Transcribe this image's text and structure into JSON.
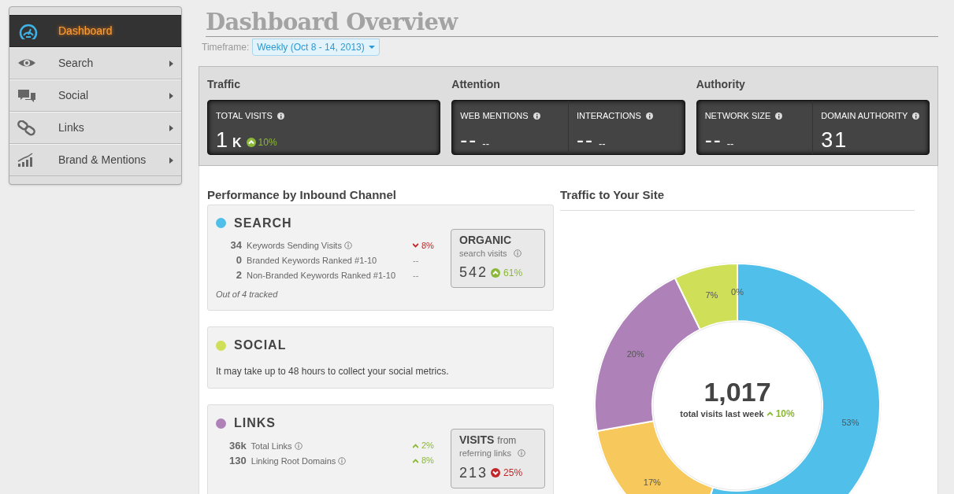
{
  "sidebar": {
    "items": [
      {
        "label": "Dashboard",
        "kind": "gauge",
        "selected": true
      },
      {
        "label": "Search",
        "kind": "eye",
        "selected": false
      },
      {
        "label": "Social",
        "kind": "bubbles",
        "selected": false
      },
      {
        "label": "Links",
        "kind": "chain",
        "selected": false
      },
      {
        "label": "Brand & Mentions",
        "kind": "bars",
        "selected": false
      }
    ]
  },
  "header": {
    "title": "Dashboard Overview",
    "timeframe_label": "Timeframe:",
    "timeframe": "Weekly (Oct 8 - 14, 2013)"
  },
  "summary": [
    {
      "title": "Traffic",
      "metrics": [
        {
          "label": "TOTAL VISITS",
          "value": "1",
          "unit": "K",
          "change": "10%",
          "kind": "up"
        }
      ]
    },
    {
      "title": "Attention",
      "metrics": [
        {
          "label": "WEB MENTIONS",
          "value": "--",
          "unit": "--"
        },
        {
          "label": "INTERACTIONS",
          "value": "--",
          "unit": "--"
        }
      ]
    },
    {
      "title": "Authority",
      "metrics": [
        {
          "label": "NETWORK SIZE",
          "value": "--",
          "unit": "--"
        },
        {
          "label": "DOMAIN AUTHORITY",
          "value": "31"
        }
      ]
    }
  ],
  "performance": {
    "title": "Performance by Inbound Channel",
    "channels": [
      {
        "name": "SEARCH",
        "color": "#4fbfea",
        "rows": [
          {
            "text": "**34** Keywords Sending Visits",
            "info": true,
            "change": "8%",
            "kind": "down"
          },
          {
            "text": "**0** Branded Keywords Ranked #1-10",
            "info": false,
            "change": "--",
            "kind": "flat"
          },
          {
            "text": "**2** Non-Branded Keywords Ranked #1-10",
            "info": false,
            "change": "--",
            "kind": "flat"
          }
        ],
        "note": "Out of 4 tracked",
        "box": {
          "title": "ORGANIC",
          "subtitle": "search visits",
          "value": "542",
          "change": "61%",
          "kind": "up"
        }
      },
      {
        "name": "SOCIAL",
        "color": "#cfe058",
        "message": "It may take up to 48 hours to collect your social metrics."
      },
      {
        "name": "LINKS",
        "color": "#ae82b9",
        "rows": [
          {
            "text": "**36k** Total Links",
            "info": true,
            "change": "2%",
            "kind": "up"
          },
          {
            "text": "**130** Linking Root Domains",
            "info": true,
            "change": "8%",
            "kind": "up"
          }
        ],
        "box": {
          "title": "VISITS",
          "title_suffix": "from",
          "subtitle": "referring links",
          "value": "213",
          "change": "25%",
          "kind": "down"
        }
      }
    ]
  },
  "traffic": {
    "title": "Traffic to Your Site",
    "chart_data": {
      "type": "donut",
      "values": [
        53,
        17,
        20,
        7,
        0
      ],
      "data_labels": true,
      "value_labels": [
        "53%",
        "17%",
        "20%",
        "7%",
        "0%"
      ]
    },
    "slices": [
      {
        "color": "#50bfea"
      },
      {
        "color": "#f7c95c"
      },
      {
        "color": "#ae82b9"
      },
      {
        "color": "#cfe058"
      }
    ],
    "center_value": "1,017",
    "center_label": "total visits last week",
    "change": "10%",
    "kind": "up"
  }
}
